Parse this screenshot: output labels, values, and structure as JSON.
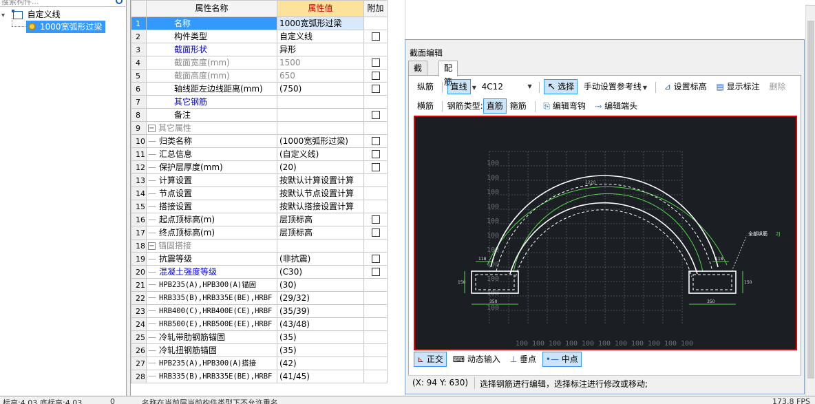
{
  "tree": {
    "search_placeholder": "搜索构件...",
    "root_label": "自定义线",
    "child_label": "1000宽弧形过梁"
  },
  "grid": {
    "headers": {
      "num": "",
      "name": "属性名称",
      "value": "属性值",
      "extra": "附加"
    },
    "rows": [
      {
        "num": "1",
        "name": "名称",
        "value": "1000宽弧形过梁",
        "check": false,
        "style": "sel"
      },
      {
        "num": "2",
        "name": "构件类型",
        "value": "自定义线",
        "check": true,
        "style": ""
      },
      {
        "num": "3",
        "name": "截面形状",
        "value": "异形",
        "check": false,
        "style": "blue"
      },
      {
        "num": "4",
        "name": "截面宽度(mm)",
        "value": "1500",
        "check": true,
        "style": "gray"
      },
      {
        "num": "5",
        "name": "截面高度(mm)",
        "value": "650",
        "check": true,
        "style": "gray"
      },
      {
        "num": "6",
        "name": "轴线距左边线距离(mm)",
        "value": "(750)",
        "check": true,
        "style": ""
      },
      {
        "num": "7",
        "name": "其它钢筋",
        "value": "",
        "check": false,
        "style": "blue"
      },
      {
        "num": "8",
        "name": "备注",
        "value": "",
        "check": true,
        "style": ""
      },
      {
        "num": "9",
        "name": "其它属性",
        "value": "",
        "check": false,
        "style": "group"
      },
      {
        "num": "10",
        "name": "归类名称",
        "value": "(1000宽弧形过梁)",
        "check": true,
        "style": "child"
      },
      {
        "num": "11",
        "name": "汇总信息",
        "value": "(自定义线)",
        "check": true,
        "style": "child"
      },
      {
        "num": "12",
        "name": "保护层厚度(mm)",
        "value": "(20)",
        "check": true,
        "style": "child"
      },
      {
        "num": "13",
        "name": "计算设置",
        "value": "按默认计算设置计算",
        "check": false,
        "style": "child"
      },
      {
        "num": "14",
        "name": "节点设置",
        "value": "按默认节点设置计算",
        "check": false,
        "style": "child"
      },
      {
        "num": "15",
        "name": "搭接设置",
        "value": "按默认搭接设置计算",
        "check": false,
        "style": "child"
      },
      {
        "num": "16",
        "name": "起点顶标高(m)",
        "value": "层顶标高",
        "check": true,
        "style": "child"
      },
      {
        "num": "17",
        "name": "终点顶标高(m)",
        "value": "层顶标高",
        "check": true,
        "style": "child"
      },
      {
        "num": "18",
        "name": "锚固搭接",
        "value": "",
        "check": false,
        "style": "group"
      },
      {
        "num": "19",
        "name": "抗震等级",
        "value": "(非抗震)",
        "check": true,
        "style": "child"
      },
      {
        "num": "20",
        "name": "混凝土强度等级",
        "value": "(C30)",
        "check": true,
        "style": "childblue"
      },
      {
        "num": "21",
        "name": "HPB235(A),HPB300(A)锚固",
        "value": "(30)",
        "check": false,
        "style": "childmono"
      },
      {
        "num": "22",
        "name": "HRB335(B),HRB335E(BE),HRBF",
        "value": "(29/32)",
        "check": false,
        "style": "childmono"
      },
      {
        "num": "23",
        "name": "HRB400(C),HRB400E(CE),HRBF",
        "value": "(35/39)",
        "check": false,
        "style": "childmono"
      },
      {
        "num": "24",
        "name": "HRB500(E),HRB500E(EE),HRBF",
        "value": "(43/48)",
        "check": false,
        "style": "childmono"
      },
      {
        "num": "25",
        "name": "冷轧带肋钢筋锚固",
        "value": "(35)",
        "check": false,
        "style": "child"
      },
      {
        "num": "26",
        "name": "冷轧扭钢筋锚固",
        "value": "(35)",
        "check": false,
        "style": "child"
      },
      {
        "num": "27",
        "name": "HPB235(A),HPB300(A)搭接",
        "value": "(42)",
        "check": false,
        "style": "childmono"
      },
      {
        "num": "28",
        "name": "HRB335(B),HRB335E(BE),HRBF",
        "value": "(41/45)",
        "check": false,
        "style": "childmono"
      }
    ]
  },
  "dialog": {
    "title": "截面编辑",
    "tabs": [
      "截面",
      "配筋"
    ],
    "toolbar1": {
      "label_longitudinal": "纵筋",
      "line_btn": "直线",
      "rebar_combo": "4C12",
      "select_btn": "选择",
      "ref_line": "手动设置参考线",
      "set_elev": "设置标高",
      "show_dim": "显示标注",
      "delete": "删除"
    },
    "toolbar2": {
      "transverse": "横筋",
      "type_label": "钢筋类型:",
      "straight": "直筋",
      "stirrup": "箍筋",
      "edit_hook": "编辑弯钩",
      "edit_end": "编辑端头"
    },
    "canvas": {
      "grid_label": "100",
      "dim_top": "1220",
      "dim_left_small": "118",
      "dim_right_small": "118",
      "dim_side": "150",
      "dim_bottom_left": "350",
      "dim_bottom_right": "350",
      "annotation": "全部纵筋",
      "annotation_value": "2J"
    },
    "bottom": {
      "ortho": "正交",
      "dynamic_input": "动态输入",
      "perpendicular": "垂点",
      "midpoint": "中点"
    },
    "status": {
      "coord": "(X: 94 Y: 630)",
      "message": "选择钢筋进行编辑，选择标注进行修改或移动;"
    }
  },
  "statusbar": {
    "item1": "标高:4.03",
    "item2": "底标高:4.03",
    "item3": "0",
    "item4": "名称在当前层当前构件类型下不允许重名",
    "item5": "173.8 FPS"
  }
}
